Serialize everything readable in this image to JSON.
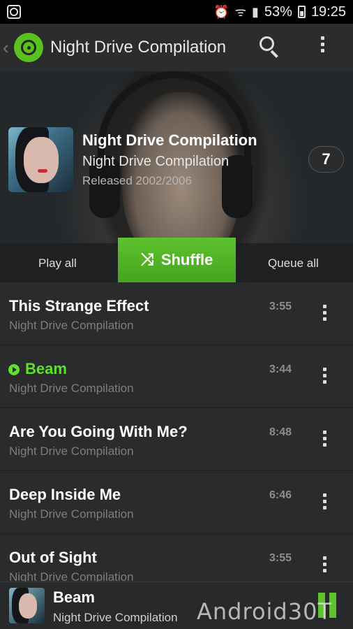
{
  "statusbar": {
    "left_icon": "screenshot-icon",
    "icons": [
      "alarm-icon",
      "wifi-icon",
      "signal-icon"
    ],
    "battery_percent": "53%",
    "time": "19:25"
  },
  "appbar": {
    "back_glyph": "‹",
    "title": "Night Drive Compilation",
    "icons": [
      "app-disc-icon",
      "search-icon",
      "overflow-menu-icon"
    ]
  },
  "album": {
    "title": "Night Drive Compilation",
    "subtitle": "Night Drive Compilation",
    "released": "Released 2002/2006",
    "track_count": "7"
  },
  "actions": {
    "play_all": "Play all",
    "shuffle": "Shuffle",
    "shuffle_icon": "⤨",
    "queue_all": "Queue all"
  },
  "tracks": [
    {
      "title": "This Strange Effect",
      "artist": "Night Drive Compilation",
      "duration": "3:55",
      "playing": false
    },
    {
      "title": "Beam",
      "artist": "Night Drive Compilation",
      "duration": "3:44",
      "playing": true
    },
    {
      "title": "Are You Going With Me?",
      "artist": "Night Drive Compilation",
      "duration": "8:48",
      "playing": false
    },
    {
      "title": "Deep Inside Me",
      "artist": "Night Drive Compilation",
      "duration": "6:46",
      "playing": false
    },
    {
      "title": "Out of Sight",
      "artist": "Night Drive Compilation",
      "duration": "3:55",
      "playing": false
    }
  ],
  "now_playing": {
    "title": "Beam",
    "subtitle": "Night Drive Compilation",
    "control": "pause-icon"
  },
  "watermark": "Android30T",
  "colors": {
    "accent": "#5ec22e",
    "active_track": "#5ee02c",
    "background": "#2a2b2d"
  }
}
